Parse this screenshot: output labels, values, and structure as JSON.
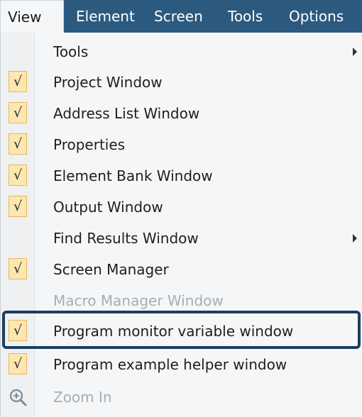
{
  "menubar": {
    "items": [
      {
        "label": "View",
        "active": true
      },
      {
        "label": "Element",
        "active": false
      },
      {
        "label": "Screen",
        "active": false
      },
      {
        "label": "Tools",
        "active": false
      },
      {
        "label": "Options",
        "active": false
      }
    ]
  },
  "view_menu": {
    "items": [
      {
        "label": "Tools",
        "checked": false,
        "enabled": true,
        "submenu": true
      },
      {
        "label": "Project Window",
        "checked": true,
        "enabled": true
      },
      {
        "label": "Address List Window",
        "checked": true,
        "enabled": true
      },
      {
        "label": "Properties",
        "checked": true,
        "enabled": true
      },
      {
        "label": "Element Bank Window",
        "checked": true,
        "enabled": true
      },
      {
        "label": "Output Window",
        "checked": true,
        "enabled": true
      },
      {
        "label": "Find Results Window",
        "checked": false,
        "enabled": true,
        "submenu": true
      },
      {
        "label": "Screen Manager",
        "checked": true,
        "enabled": true
      },
      {
        "label": "Macro Manager Window",
        "checked": false,
        "enabled": false
      },
      {
        "label": "Program monitor variable window",
        "checked": true,
        "enabled": true,
        "highlighted": true
      },
      {
        "label": "Program example helper window",
        "checked": true,
        "enabled": true
      },
      {
        "label": "Zoom In",
        "checked": false,
        "enabled": false,
        "icon": "zoom-in-icon"
      }
    ],
    "check_glyph": "√"
  },
  "colors": {
    "menubar_bg": "#2c5a7f",
    "check_bg": "#fde7b0",
    "check_border": "#e8b75b",
    "highlight_border": "#1c3e60",
    "disabled_text": "#a8adb2"
  }
}
